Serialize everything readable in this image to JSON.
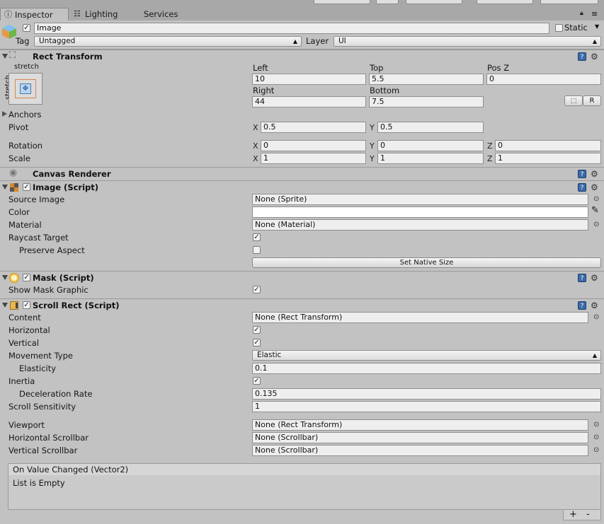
{
  "tabs": [
    {
      "label": "Inspector"
    },
    {
      "label": "Lighting"
    },
    {
      "label": "Services"
    }
  ],
  "object": {
    "name": "Image",
    "static_label": "Static",
    "tag_label": "Tag",
    "tag_value": "Untagged",
    "layer_label": "Layer",
    "layer_value": "UI"
  },
  "rect_transform": {
    "title": "Rect Transform",
    "anchor_preset_top": "stretch",
    "anchor_preset_side": "stretch",
    "left_label": "Left",
    "left": "10",
    "top_label": "Top",
    "top": "5.5",
    "posz_label": "Pos Z",
    "posz": "0",
    "right_label": "Right",
    "right": "44",
    "bottom_label": "Bottom",
    "bottom": "7.5",
    "r_button": "R",
    "anchors_label": "Anchors",
    "pivot_label": "Pivot",
    "pivot_x": "0.5",
    "pivot_y": "0.5",
    "rotation_label": "Rotation",
    "rot_x": "0",
    "rot_y": "0",
    "rot_z": "0",
    "scale_label": "Scale",
    "scale_x": "1",
    "scale_y": "1",
    "scale_z": "1",
    "axis_x": "X",
    "axis_y": "Y",
    "axis_z": "Z"
  },
  "canvas_renderer": {
    "title": "Canvas Renderer"
  },
  "image_script": {
    "title": "Image (Script)",
    "source_image_label": "Source Image",
    "source_image": "None (Sprite)",
    "color_label": "Color",
    "material_label": "Material",
    "material": "None (Material)",
    "raycast_label": "Raycast Target",
    "preserve_label": "Preserve Aspect",
    "native_size_button": "Set Native Size"
  },
  "mask_script": {
    "title": "Mask (Script)",
    "show_graphic_label": "Show Mask Graphic"
  },
  "scroll_rect": {
    "title": "Scroll Rect (Script)",
    "content_label": "Content",
    "content": "None (Rect Transform)",
    "horizontal_label": "Horizontal",
    "vertical_label": "Vertical",
    "movement_label": "Movement Type",
    "movement": "Elastic",
    "elasticity_label": "Elasticity",
    "elasticity": "0.1",
    "inertia_label": "Inertia",
    "decel_label": "Deceleration Rate",
    "decel": "0.135",
    "sensitivity_label": "Scroll Sensitivity",
    "sensitivity": "1",
    "viewport_label": "Viewport",
    "viewport": "None (Rect Transform)",
    "hscroll_label": "Horizontal Scrollbar",
    "hscroll": "None (Scrollbar)",
    "vscroll_label": "Vertical Scrollbar",
    "vscroll": "None (Scrollbar)"
  },
  "event": {
    "title": "On Value Changed (Vector2)",
    "empty": "List is Empty",
    "add": "+",
    "remove": "-"
  },
  "colors": {
    "panel": "#c2c2c2",
    "field": "#eeeeee",
    "help_icon": "#3a6aa8"
  },
  "icons": [
    "inspector-icon",
    "lighting-icon",
    "lock-icon",
    "menu-icon",
    "gameobject-cube-icon",
    "help-icon",
    "gear-icon",
    "object-picker-icon",
    "eyedropper-icon"
  ]
}
